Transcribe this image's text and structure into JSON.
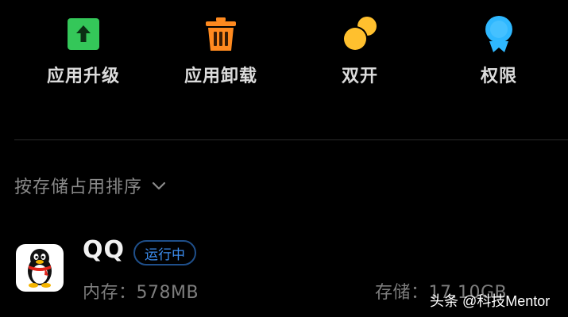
{
  "actions": [
    {
      "label": "应用升级",
      "icon": "upgrade-arrow-icon"
    },
    {
      "label": "应用卸载",
      "icon": "trash-icon"
    },
    {
      "label": "双开",
      "icon": "dual-circles-icon"
    },
    {
      "label": "权限",
      "icon": "permission-badge-icon"
    }
  ],
  "sort": {
    "label": "按存储占用排序",
    "icon": "chevron-down-icon"
  },
  "app": {
    "name": "QQ",
    "status": "运行中",
    "memory": "内存：578MB",
    "storage": "存储：17.10GB",
    "icon": "qq-penguin-icon"
  },
  "watermark": "头条 @科技Mentor",
  "colors": {
    "upgrade_green": "#34c759",
    "trash_orange": "#ff8a1f",
    "dual_yellow": "#ffc02e",
    "perm_cyan": "#2fb8ff",
    "status_blue": "#3d8ef0",
    "background": "#000000"
  }
}
